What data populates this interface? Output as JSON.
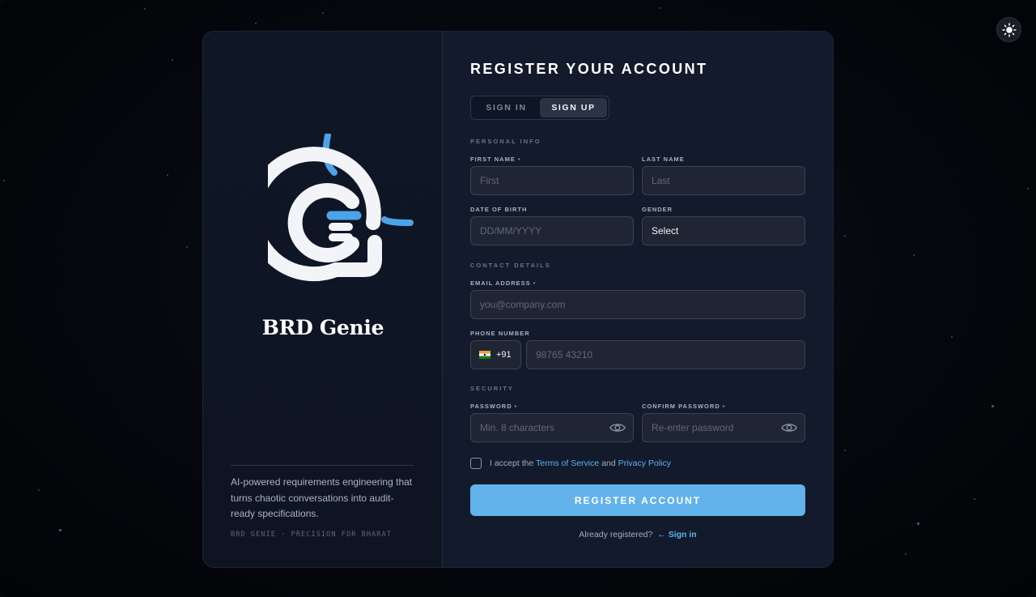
{
  "app": {
    "brand_name": "BRD Genie",
    "tagline": "AI-powered requirements engineering that turns chaotic conversations into audit-ready specifications.",
    "footer_text": "BRD GENIE · PRECISION FOR BHARAT",
    "theme_toggle_icon": "sun-icon"
  },
  "form": {
    "title": "REGISTER YOUR ACCOUNT",
    "tabs": [
      {
        "label": "SIGN IN",
        "active": false
      },
      {
        "label": "SIGN UP",
        "active": true
      }
    ],
    "sections": {
      "personal": "PERSONAL INFO",
      "contact": "CONTACT DETAILS",
      "security": "SECURITY"
    },
    "fields": {
      "first_name": {
        "label": "FIRST NAME",
        "required": true,
        "placeholder": "First",
        "value": ""
      },
      "last_name": {
        "label": "LAST NAME",
        "required": false,
        "placeholder": "Last",
        "value": ""
      },
      "dob": {
        "label": "DATE OF BIRTH",
        "required": false,
        "placeholder": "DD/MM/YYYY",
        "value": ""
      },
      "gender": {
        "label": "GENDER",
        "required": false,
        "value": "Select"
      },
      "email": {
        "label": "EMAIL ADDRESS",
        "required": true,
        "placeholder": "you@company.com",
        "value": ""
      },
      "phone": {
        "label": "PHONE NUMBER",
        "required": false,
        "country_code": "+91",
        "placeholder": "98765 43210",
        "value": ""
      },
      "password": {
        "label": "PASSWORD",
        "required": true,
        "placeholder": "Min. 8 characters",
        "value": ""
      },
      "confirm_password": {
        "label": "CONFIRM PASSWORD",
        "required": true,
        "placeholder": "Re-enter password",
        "value": ""
      }
    },
    "terms": {
      "prefix": "I accept the",
      "terms_link": "Terms of Service",
      "and": "and",
      "privacy_link": "Privacy Policy",
      "checked": false
    },
    "submit_label": "REGISTER ACCOUNT",
    "already_text": "Already registered?",
    "signin_link": "← Sign in"
  },
  "colors": {
    "accent": "#62b3ec",
    "card_bg": "#121a2b",
    "field_bg": "#1f2532",
    "required_dot": "#4da3e8"
  }
}
